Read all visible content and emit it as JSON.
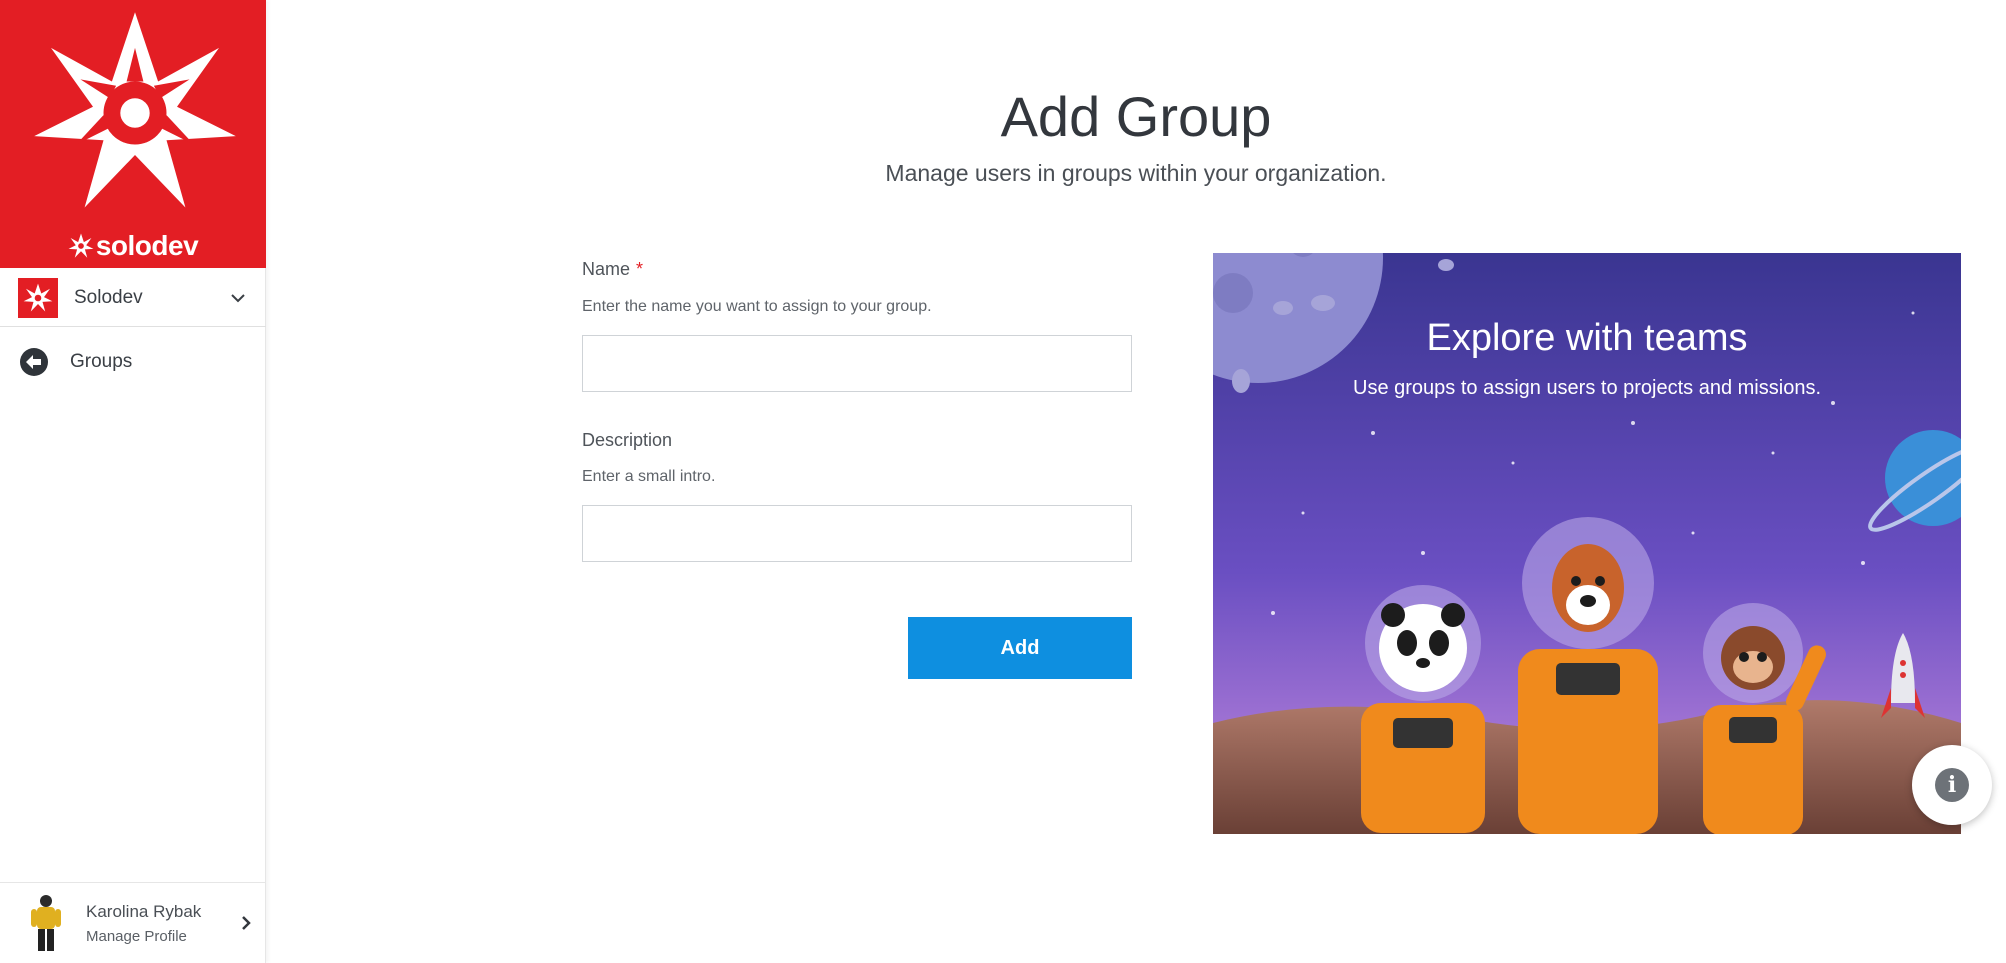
{
  "brand": {
    "wordmark": "solodev",
    "color": "#e31e24"
  },
  "sidebar": {
    "org_name": "Solodev",
    "nav_back_label": "Groups",
    "profile": {
      "name": "Karolina Rybak",
      "sub": "Manage Profile"
    }
  },
  "page": {
    "title": "Add Group",
    "subtitle": "Manage users in groups within your organization."
  },
  "form": {
    "name_label": "Name",
    "name_required": "*",
    "name_help": "Enter the name you want to assign to your group.",
    "name_value": "",
    "description_label": "Description",
    "description_help": "Enter a small intro.",
    "description_value": "",
    "submit_label": "Add",
    "submit_color": "#0e8fe0"
  },
  "promo": {
    "title": "Explore with teams",
    "subtitle": "Use groups to assign users to projects and missions."
  },
  "icons": {
    "info": "i"
  }
}
